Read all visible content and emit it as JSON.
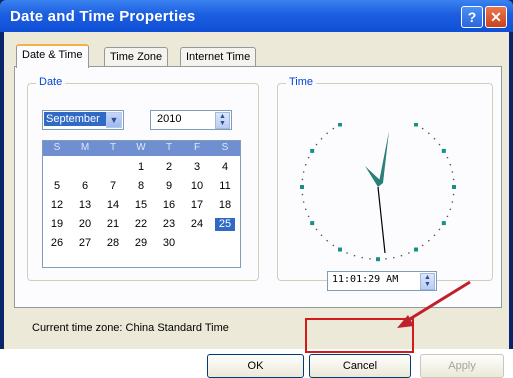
{
  "window": {
    "title": "Date and Time Properties",
    "help_glyph": "?",
    "close_glyph": "✕"
  },
  "tabs": [
    "Date & Time",
    "Time Zone",
    "Internet Time"
  ],
  "date_group": {
    "label": "Date",
    "month": "September",
    "year": "2010",
    "weekday_headers": [
      "S",
      "M",
      "T",
      "W",
      "T",
      "F",
      "S"
    ],
    "weeks": [
      [
        "",
        "",
        "",
        "1",
        "2",
        "3",
        "4"
      ],
      [
        "5",
        "6",
        "7",
        "8",
        "9",
        "10",
        "11"
      ],
      [
        "12",
        "13",
        "14",
        "15",
        "16",
        "17",
        "18"
      ],
      [
        "19",
        "20",
        "21",
        "22",
        "23",
        "24",
        "25"
      ],
      [
        "26",
        "27",
        "28",
        "29",
        "30",
        "",
        ""
      ]
    ],
    "selected_day": "25"
  },
  "time_group": {
    "label": "Time",
    "time_value": "11:01:29 AM"
  },
  "timezone_text": "Current time zone:  China Standard Time",
  "buttons": {
    "ok": "OK",
    "cancel": "Cancel",
    "apply": "Apply"
  },
  "colors": {
    "title_bar": "#1c5ee0",
    "accent_highlight": "#d41a1a",
    "selection": "#316ac5",
    "group_label": "#0046d5"
  }
}
